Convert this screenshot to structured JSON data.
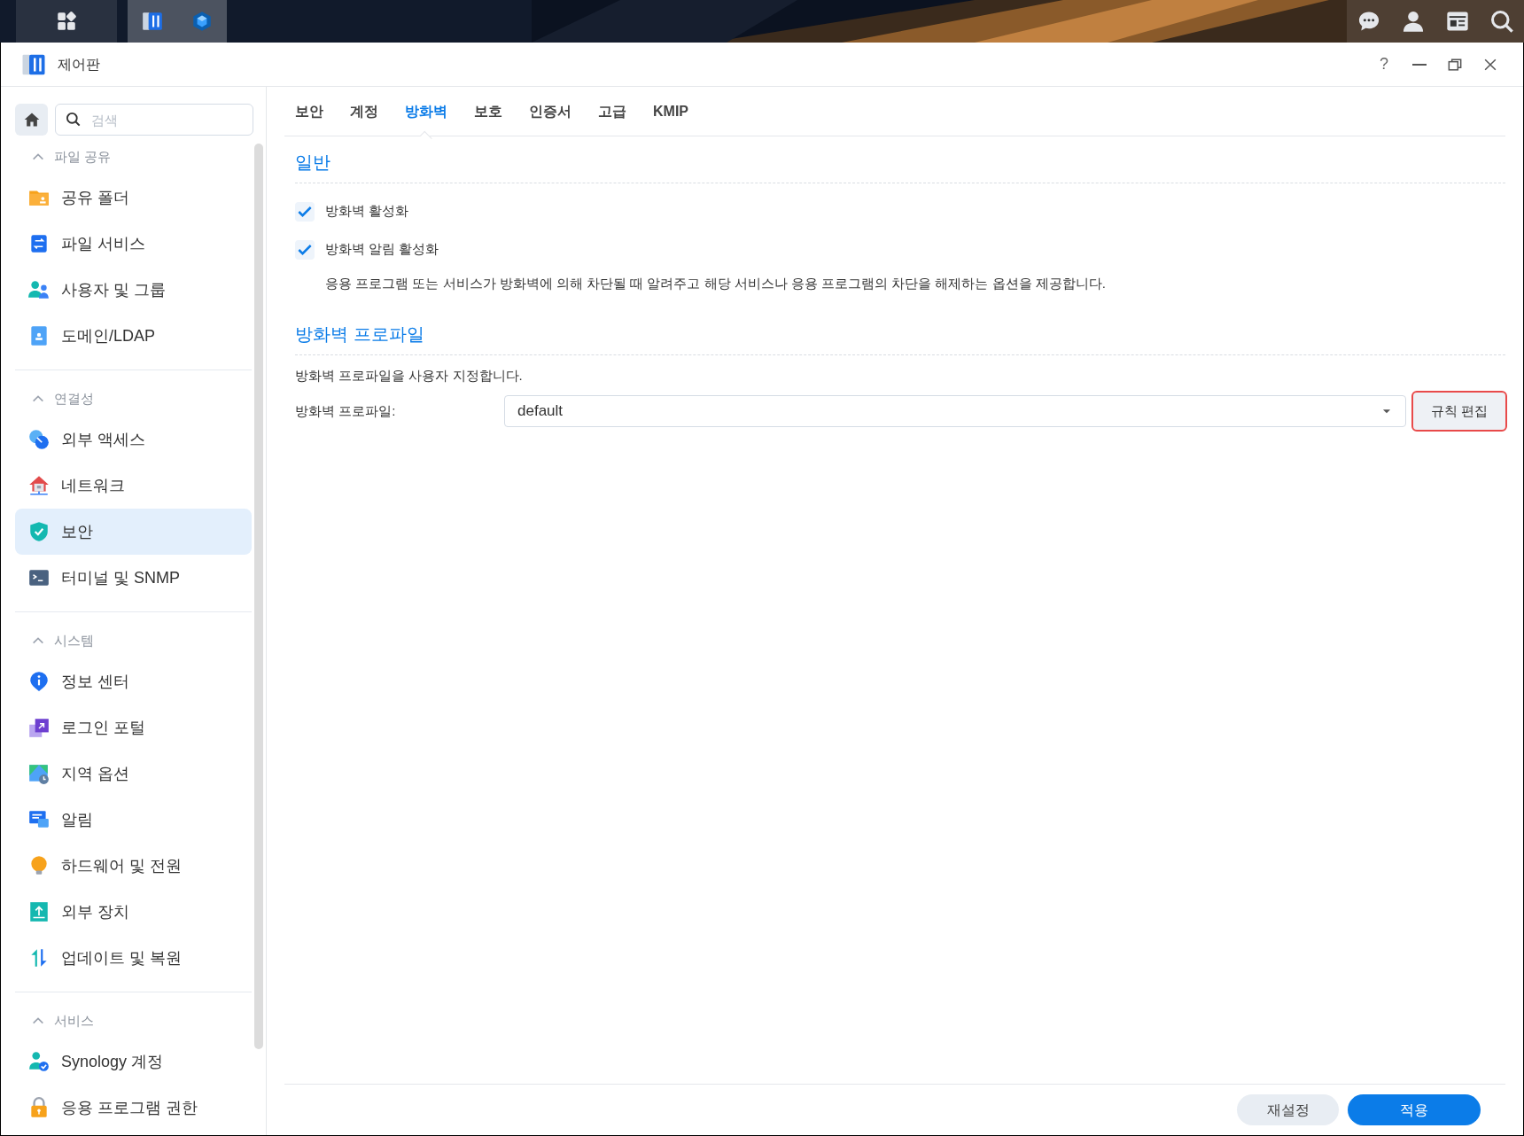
{
  "taskbar": {
    "apps": [
      {
        "kind": "grid",
        "selected": false
      },
      {
        "kind": "control-panel",
        "selected": true
      },
      {
        "kind": "cube",
        "selected": true
      }
    ]
  },
  "window": {
    "title": "제어판",
    "controls": [
      "?"
    ]
  },
  "sidebar": {
    "search": {
      "placeholder": "검색"
    },
    "groups": [
      {
        "title": "파일 공유",
        "expanded": true,
        "items": [
          {
            "label": "공유 폴더",
            "selected": false
          },
          {
            "label": "파일 서비스",
            "selected": false
          },
          {
            "label": "사용자 및 그룹",
            "selected": false
          },
          {
            "label": "도메인/LDAP",
            "selected": false
          }
        ]
      },
      {
        "title": "연결성",
        "expanded": true,
        "items": [
          {
            "label": "외부 액세스",
            "selected": false
          },
          {
            "label": "네트워크",
            "selected": false
          },
          {
            "label": "보안",
            "selected": true
          },
          {
            "label": "터미널 및 SNMP",
            "selected": false
          }
        ]
      },
      {
        "title": "시스템",
        "expanded": true,
        "items": [
          {
            "label": "정보 센터",
            "selected": false
          },
          {
            "label": "로그인 포털",
            "selected": false
          },
          {
            "label": "지역 옵션",
            "selected": false
          },
          {
            "label": "알림",
            "selected": false
          },
          {
            "label": "하드웨어 및 전원",
            "selected": false
          },
          {
            "label": "외부 장치",
            "selected": false
          },
          {
            "label": "업데이트 및 복원",
            "selected": false
          }
        ]
      },
      {
        "title": "서비스",
        "expanded": true,
        "items": [
          {
            "label": "Synology 계정",
            "selected": false
          },
          {
            "label": "응용 프로그램 권한",
            "selected": false
          }
        ]
      }
    ]
  },
  "tabs": [
    {
      "label": "보안",
      "selected": false
    },
    {
      "label": "계정",
      "selected": false
    },
    {
      "label": "방화벽",
      "selected": true
    },
    {
      "label": "보호",
      "selected": false
    },
    {
      "label": "인증서",
      "selected": false
    },
    {
      "label": "고급",
      "selected": false
    },
    {
      "label": "KMIP",
      "selected": false
    }
  ],
  "sections": [
    {
      "title": "일반",
      "checkboxes": [
        {
          "label": "방화벽 활성화",
          "checked": true
        },
        {
          "label": "방화벽 알림 활성화",
          "checked": true,
          "note": "응용 프로그램 또는 서비스가 방화벽에 의해 차단될 때 알려주고 해당 서비스나 응용 프로그램의 차단을 해제하는 옵션을 제공합니다."
        }
      ]
    },
    {
      "title": "방화벽 프로파일",
      "description": "방화벽 프로파일을 사용자 지정합니다.",
      "field": {
        "label": "방화벽 프로파일:",
        "value": "default"
      },
      "button": {
        "label": "규칙 편집",
        "highlighted": true
      }
    }
  ],
  "footer": {
    "buttons": [
      {
        "label": "재설정",
        "kind": "secondary"
      },
      {
        "label": "적용",
        "kind": "primary"
      }
    ]
  }
}
